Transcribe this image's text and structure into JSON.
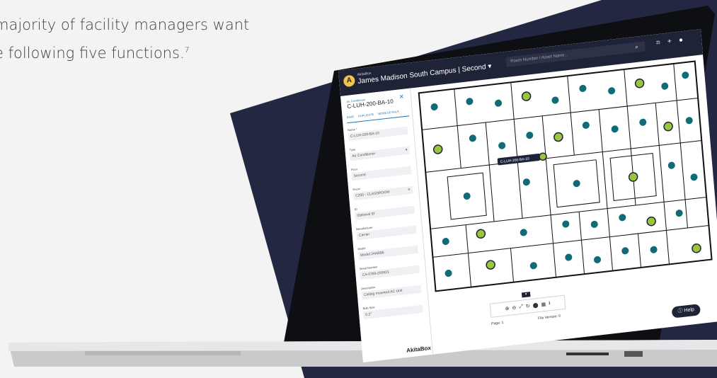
{
  "page": {
    "copy_line1": "majority of facility managers want",
    "copy_line2": "e following five functions.",
    "copy_sup": "7"
  },
  "colors": {
    "navy": "#1f2337",
    "teal": "#0f6b78",
    "green": "#9bc53d",
    "accent_blue": "#1b75bb"
  },
  "app": {
    "brand_small": "AkitaBox",
    "campus_title": "James Madison South Campus | Second ▾",
    "search_placeholder": "Room Number / Asset Name...",
    "icons": [
      "search-icon",
      "scan-icon",
      "plus-icon",
      "user-icon",
      "map-pin-icon"
    ]
  },
  "sidebar": {
    "category": "Air Conditioner",
    "title": "C-LUH-200-BA-10",
    "actions": [
      "SAVE",
      "DUPLICATE",
      "MORE DETAILS"
    ],
    "fields": [
      {
        "label": "Name *",
        "value": "C-LUH-200-BA-10"
      },
      {
        "label": "Type",
        "value": "Air Conditioner"
      },
      {
        "label": "Floor",
        "value": "Second"
      },
      {
        "label": "Room",
        "value": "C200 - CLASSROOM"
      },
      {
        "label": "ID",
        "value": "Optional ID"
      },
      {
        "label": "Manufacturer",
        "value": "Carrier"
      },
      {
        "label": "Model",
        "value": "Model 24ABB6"
      },
      {
        "label": "Serial Number",
        "value": "CA-0789-200921"
      },
      {
        "label": "Description",
        "value": "Ceiling mounted AC Unit"
      },
      {
        "label": "Bulb Size",
        "value": "0.2\""
      }
    ],
    "logo": "AkitaBox"
  },
  "plan": {
    "selected_label": "C-LUH-200-BA-10",
    "page_label": "Page: 1",
    "file_version_label": "File Version: 0",
    "toolbar_icons": [
      "zoom-in-icon",
      "zoom-out-icon",
      "fit-icon",
      "rotate-icon",
      "pin-icon",
      "layers-icon",
      "download-icon"
    ],
    "help_label": "Help"
  }
}
